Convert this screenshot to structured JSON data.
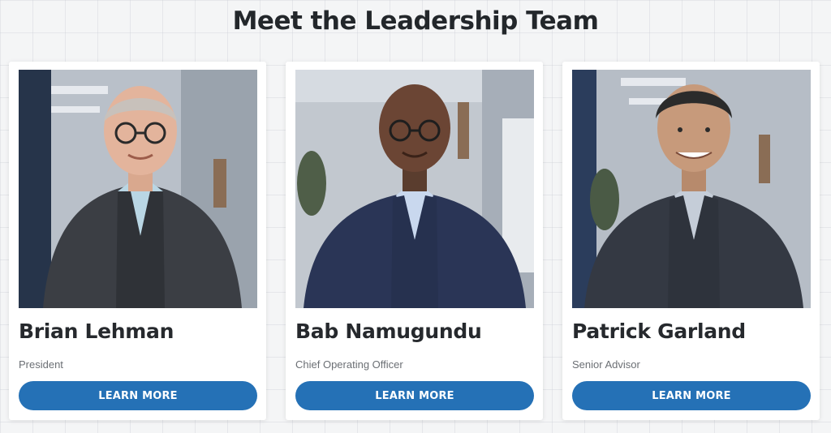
{
  "section": {
    "title": "Meet the Leadership Team"
  },
  "team": [
    {
      "name": "Brian Lehman",
      "title": "President",
      "button_label": "LEARN MORE"
    },
    {
      "name": "Bab Namugundu",
      "title": "Chief Operating Officer",
      "button_label": "LEARN MORE"
    },
    {
      "name": "Patrick Garland",
      "title": "Senior Advisor",
      "button_label": "LEARN MORE"
    }
  ],
  "colors": {
    "accent": "#2571b6",
    "heading": "#23272b",
    "subtext": "#6b6f74"
  },
  "icons": {
    "photo": "portrait-photo"
  }
}
